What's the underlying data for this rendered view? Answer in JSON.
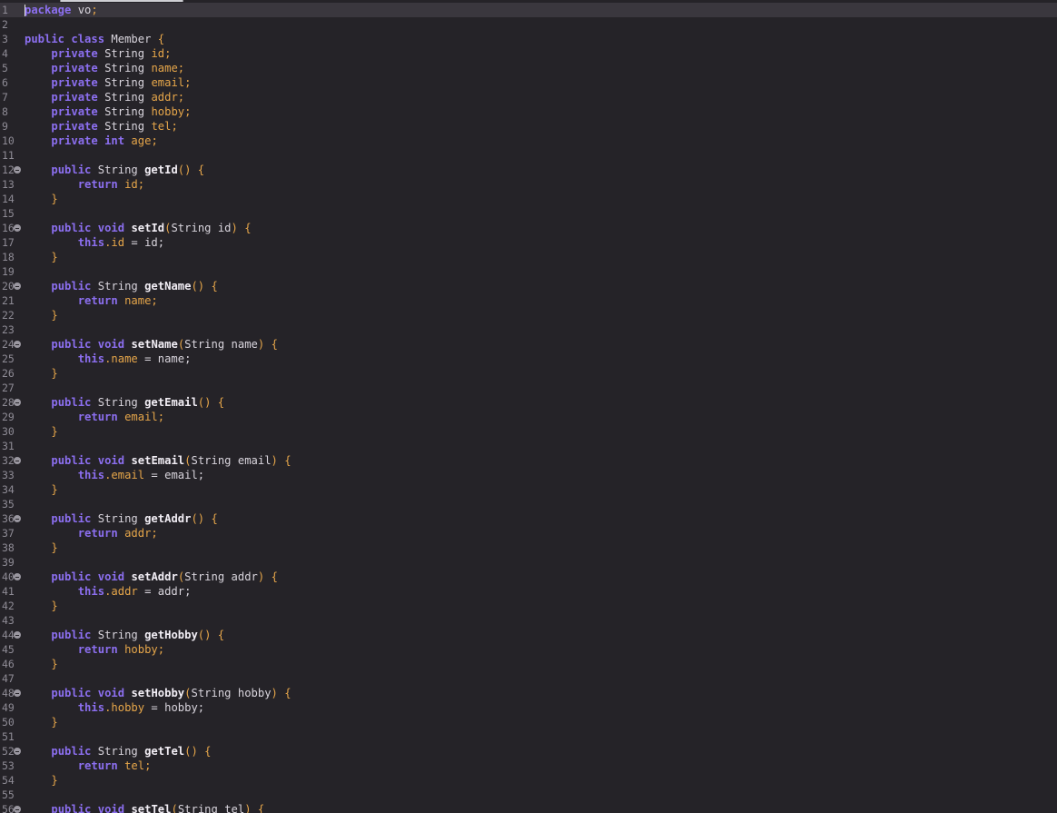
{
  "editor": {
    "language": "java",
    "current_line": 1,
    "colors": {
      "background": "#252328",
      "current_line": "#3a373e",
      "keyword": "#8c6ff0",
      "field": "#e6a64a",
      "method": "#f2eef5",
      "text": "#d9d5dd",
      "line_number": "#8e8b95"
    },
    "fold_icon": "collapse-circle-icon",
    "lines": [
      {
        "n": "1",
        "fold": false,
        "tokens": [
          {
            "t": "package",
            "c": "kw"
          },
          {
            "t": " vo",
            "c": "pl"
          },
          {
            "t": ";",
            "c": "pr"
          }
        ]
      },
      {
        "n": "2",
        "fold": false,
        "tokens": []
      },
      {
        "n": "3",
        "fold": false,
        "tokens": [
          {
            "t": "public",
            "c": "kw"
          },
          {
            "t": " ",
            "c": "pl"
          },
          {
            "t": "class",
            "c": "kw"
          },
          {
            "t": " Member ",
            "c": "ty"
          },
          {
            "t": "{",
            "c": "pr"
          }
        ]
      },
      {
        "n": "4",
        "fold": false,
        "tokens": [
          {
            "t": "    ",
            "c": "pl"
          },
          {
            "t": "private",
            "c": "kw"
          },
          {
            "t": " String ",
            "c": "ty"
          },
          {
            "t": "id;",
            "c": "fld"
          }
        ]
      },
      {
        "n": "5",
        "fold": false,
        "tokens": [
          {
            "t": "    ",
            "c": "pl"
          },
          {
            "t": "private",
            "c": "kw"
          },
          {
            "t": " String ",
            "c": "ty"
          },
          {
            "t": "name;",
            "c": "fld"
          }
        ]
      },
      {
        "n": "6",
        "fold": false,
        "tokens": [
          {
            "t": "    ",
            "c": "pl"
          },
          {
            "t": "private",
            "c": "kw"
          },
          {
            "t": " String ",
            "c": "ty"
          },
          {
            "t": "email;",
            "c": "fld"
          }
        ]
      },
      {
        "n": "7",
        "fold": false,
        "tokens": [
          {
            "t": "    ",
            "c": "pl"
          },
          {
            "t": "private",
            "c": "kw"
          },
          {
            "t": " String ",
            "c": "ty"
          },
          {
            "t": "addr;",
            "c": "fld"
          }
        ]
      },
      {
        "n": "8",
        "fold": false,
        "tokens": [
          {
            "t": "    ",
            "c": "pl"
          },
          {
            "t": "private",
            "c": "kw"
          },
          {
            "t": " String ",
            "c": "ty"
          },
          {
            "t": "hobby;",
            "c": "fld"
          }
        ]
      },
      {
        "n": "9",
        "fold": false,
        "tokens": [
          {
            "t": "    ",
            "c": "pl"
          },
          {
            "t": "private",
            "c": "kw"
          },
          {
            "t": " String ",
            "c": "ty"
          },
          {
            "t": "tel;",
            "c": "fld"
          }
        ]
      },
      {
        "n": "10",
        "fold": false,
        "tokens": [
          {
            "t": "    ",
            "c": "pl"
          },
          {
            "t": "private",
            "c": "kw"
          },
          {
            "t": " ",
            "c": "pl"
          },
          {
            "t": "int",
            "c": "kw"
          },
          {
            "t": " age;",
            "c": "fld"
          }
        ]
      },
      {
        "n": "11",
        "fold": false,
        "tokens": []
      },
      {
        "n": "12",
        "fold": true,
        "tokens": [
          {
            "t": "    ",
            "c": "pl"
          },
          {
            "t": "public",
            "c": "kw"
          },
          {
            "t": " String ",
            "c": "ty"
          },
          {
            "t": "getId",
            "c": "fn"
          },
          {
            "t": "() {",
            "c": "pr"
          }
        ]
      },
      {
        "n": "13",
        "fold": false,
        "tokens": [
          {
            "t": "        ",
            "c": "pl"
          },
          {
            "t": "return",
            "c": "kw"
          },
          {
            "t": " id;",
            "c": "fld"
          }
        ]
      },
      {
        "n": "14",
        "fold": false,
        "tokens": [
          {
            "t": "    ",
            "c": "pl"
          },
          {
            "t": "}",
            "c": "pr"
          }
        ]
      },
      {
        "n": "15",
        "fold": false,
        "tokens": []
      },
      {
        "n": "16",
        "fold": true,
        "tokens": [
          {
            "t": "    ",
            "c": "pl"
          },
          {
            "t": "public",
            "c": "kw"
          },
          {
            "t": " ",
            "c": "pl"
          },
          {
            "t": "void",
            "c": "kw"
          },
          {
            "t": " ",
            "c": "pl"
          },
          {
            "t": "setId",
            "c": "fn"
          },
          {
            "t": "(",
            "c": "pr"
          },
          {
            "t": "String ",
            "c": "ty"
          },
          {
            "t": "id",
            "c": "pl"
          },
          {
            "t": ") {",
            "c": "pr"
          }
        ]
      },
      {
        "n": "17",
        "fold": false,
        "tokens": [
          {
            "t": "        ",
            "c": "pl"
          },
          {
            "t": "this",
            "c": "kw"
          },
          {
            "t": ".id",
            "c": "fld"
          },
          {
            "t": " = id;",
            "c": "pl"
          }
        ]
      },
      {
        "n": "18",
        "fold": false,
        "tokens": [
          {
            "t": "    ",
            "c": "pl"
          },
          {
            "t": "}",
            "c": "pr"
          }
        ]
      },
      {
        "n": "19",
        "fold": false,
        "tokens": []
      },
      {
        "n": "20",
        "fold": true,
        "tokens": [
          {
            "t": "    ",
            "c": "pl"
          },
          {
            "t": "public",
            "c": "kw"
          },
          {
            "t": " String ",
            "c": "ty"
          },
          {
            "t": "getName",
            "c": "fn"
          },
          {
            "t": "() {",
            "c": "pr"
          }
        ]
      },
      {
        "n": "21",
        "fold": false,
        "tokens": [
          {
            "t": "        ",
            "c": "pl"
          },
          {
            "t": "return",
            "c": "kw"
          },
          {
            "t": " name;",
            "c": "fld"
          }
        ]
      },
      {
        "n": "22",
        "fold": false,
        "tokens": [
          {
            "t": "    ",
            "c": "pl"
          },
          {
            "t": "}",
            "c": "pr"
          }
        ]
      },
      {
        "n": "23",
        "fold": false,
        "tokens": []
      },
      {
        "n": "24",
        "fold": true,
        "tokens": [
          {
            "t": "    ",
            "c": "pl"
          },
          {
            "t": "public",
            "c": "kw"
          },
          {
            "t": " ",
            "c": "pl"
          },
          {
            "t": "void",
            "c": "kw"
          },
          {
            "t": " ",
            "c": "pl"
          },
          {
            "t": "setName",
            "c": "fn"
          },
          {
            "t": "(",
            "c": "pr"
          },
          {
            "t": "String ",
            "c": "ty"
          },
          {
            "t": "name",
            "c": "pl"
          },
          {
            "t": ") {",
            "c": "pr"
          }
        ]
      },
      {
        "n": "25",
        "fold": false,
        "tokens": [
          {
            "t": "        ",
            "c": "pl"
          },
          {
            "t": "this",
            "c": "kw"
          },
          {
            "t": ".name",
            "c": "fld"
          },
          {
            "t": " = name;",
            "c": "pl"
          }
        ]
      },
      {
        "n": "26",
        "fold": false,
        "tokens": [
          {
            "t": "    ",
            "c": "pl"
          },
          {
            "t": "}",
            "c": "pr"
          }
        ]
      },
      {
        "n": "27",
        "fold": false,
        "tokens": []
      },
      {
        "n": "28",
        "fold": true,
        "tokens": [
          {
            "t": "    ",
            "c": "pl"
          },
          {
            "t": "public",
            "c": "kw"
          },
          {
            "t": " String ",
            "c": "ty"
          },
          {
            "t": "getEmail",
            "c": "fn"
          },
          {
            "t": "() {",
            "c": "pr"
          }
        ]
      },
      {
        "n": "29",
        "fold": false,
        "tokens": [
          {
            "t": "        ",
            "c": "pl"
          },
          {
            "t": "return",
            "c": "kw"
          },
          {
            "t": " email;",
            "c": "fld"
          }
        ]
      },
      {
        "n": "30",
        "fold": false,
        "tokens": [
          {
            "t": "    ",
            "c": "pl"
          },
          {
            "t": "}",
            "c": "pr"
          }
        ]
      },
      {
        "n": "31",
        "fold": false,
        "tokens": []
      },
      {
        "n": "32",
        "fold": true,
        "tokens": [
          {
            "t": "    ",
            "c": "pl"
          },
          {
            "t": "public",
            "c": "kw"
          },
          {
            "t": " ",
            "c": "pl"
          },
          {
            "t": "void",
            "c": "kw"
          },
          {
            "t": " ",
            "c": "pl"
          },
          {
            "t": "setEmail",
            "c": "fn"
          },
          {
            "t": "(",
            "c": "pr"
          },
          {
            "t": "String ",
            "c": "ty"
          },
          {
            "t": "email",
            "c": "pl"
          },
          {
            "t": ") {",
            "c": "pr"
          }
        ]
      },
      {
        "n": "33",
        "fold": false,
        "tokens": [
          {
            "t": "        ",
            "c": "pl"
          },
          {
            "t": "this",
            "c": "kw"
          },
          {
            "t": ".email",
            "c": "fld"
          },
          {
            "t": " = email;",
            "c": "pl"
          }
        ]
      },
      {
        "n": "34",
        "fold": false,
        "tokens": [
          {
            "t": "    ",
            "c": "pl"
          },
          {
            "t": "}",
            "c": "pr"
          }
        ]
      },
      {
        "n": "35",
        "fold": false,
        "tokens": []
      },
      {
        "n": "36",
        "fold": true,
        "tokens": [
          {
            "t": "    ",
            "c": "pl"
          },
          {
            "t": "public",
            "c": "kw"
          },
          {
            "t": " String ",
            "c": "ty"
          },
          {
            "t": "getAddr",
            "c": "fn"
          },
          {
            "t": "() {",
            "c": "pr"
          }
        ]
      },
      {
        "n": "37",
        "fold": false,
        "tokens": [
          {
            "t": "        ",
            "c": "pl"
          },
          {
            "t": "return",
            "c": "kw"
          },
          {
            "t": " addr;",
            "c": "fld"
          }
        ]
      },
      {
        "n": "38",
        "fold": false,
        "tokens": [
          {
            "t": "    ",
            "c": "pl"
          },
          {
            "t": "}",
            "c": "pr"
          }
        ]
      },
      {
        "n": "39",
        "fold": false,
        "tokens": []
      },
      {
        "n": "40",
        "fold": true,
        "tokens": [
          {
            "t": "    ",
            "c": "pl"
          },
          {
            "t": "public",
            "c": "kw"
          },
          {
            "t": " ",
            "c": "pl"
          },
          {
            "t": "void",
            "c": "kw"
          },
          {
            "t": " ",
            "c": "pl"
          },
          {
            "t": "setAddr",
            "c": "fn"
          },
          {
            "t": "(",
            "c": "pr"
          },
          {
            "t": "String ",
            "c": "ty"
          },
          {
            "t": "addr",
            "c": "pl"
          },
          {
            "t": ") {",
            "c": "pr"
          }
        ]
      },
      {
        "n": "41",
        "fold": false,
        "tokens": [
          {
            "t": "        ",
            "c": "pl"
          },
          {
            "t": "this",
            "c": "kw"
          },
          {
            "t": ".addr",
            "c": "fld"
          },
          {
            "t": " = addr;",
            "c": "pl"
          }
        ]
      },
      {
        "n": "42",
        "fold": false,
        "tokens": [
          {
            "t": "    ",
            "c": "pl"
          },
          {
            "t": "}",
            "c": "pr"
          }
        ]
      },
      {
        "n": "43",
        "fold": false,
        "tokens": []
      },
      {
        "n": "44",
        "fold": true,
        "tokens": [
          {
            "t": "    ",
            "c": "pl"
          },
          {
            "t": "public",
            "c": "kw"
          },
          {
            "t": " String ",
            "c": "ty"
          },
          {
            "t": "getHobby",
            "c": "fn"
          },
          {
            "t": "() {",
            "c": "pr"
          }
        ]
      },
      {
        "n": "45",
        "fold": false,
        "tokens": [
          {
            "t": "        ",
            "c": "pl"
          },
          {
            "t": "return",
            "c": "kw"
          },
          {
            "t": " hobby;",
            "c": "fld"
          }
        ]
      },
      {
        "n": "46",
        "fold": false,
        "tokens": [
          {
            "t": "    ",
            "c": "pl"
          },
          {
            "t": "}",
            "c": "pr"
          }
        ]
      },
      {
        "n": "47",
        "fold": false,
        "tokens": []
      },
      {
        "n": "48",
        "fold": true,
        "tokens": [
          {
            "t": "    ",
            "c": "pl"
          },
          {
            "t": "public",
            "c": "kw"
          },
          {
            "t": " ",
            "c": "pl"
          },
          {
            "t": "void",
            "c": "kw"
          },
          {
            "t": " ",
            "c": "pl"
          },
          {
            "t": "setHobby",
            "c": "fn"
          },
          {
            "t": "(",
            "c": "pr"
          },
          {
            "t": "String ",
            "c": "ty"
          },
          {
            "t": "hobby",
            "c": "pl"
          },
          {
            "t": ") {",
            "c": "pr"
          }
        ]
      },
      {
        "n": "49",
        "fold": false,
        "tokens": [
          {
            "t": "        ",
            "c": "pl"
          },
          {
            "t": "this",
            "c": "kw"
          },
          {
            "t": ".hobby",
            "c": "fld"
          },
          {
            "t": " = hobby;",
            "c": "pl"
          }
        ]
      },
      {
        "n": "50",
        "fold": false,
        "tokens": [
          {
            "t": "    ",
            "c": "pl"
          },
          {
            "t": "}",
            "c": "pr"
          }
        ]
      },
      {
        "n": "51",
        "fold": false,
        "tokens": []
      },
      {
        "n": "52",
        "fold": true,
        "tokens": [
          {
            "t": "    ",
            "c": "pl"
          },
          {
            "t": "public",
            "c": "kw"
          },
          {
            "t": " String ",
            "c": "ty"
          },
          {
            "t": "getTel",
            "c": "fn"
          },
          {
            "t": "() {",
            "c": "pr"
          }
        ]
      },
      {
        "n": "53",
        "fold": false,
        "tokens": [
          {
            "t": "        ",
            "c": "pl"
          },
          {
            "t": "return",
            "c": "kw"
          },
          {
            "t": " tel;",
            "c": "fld"
          }
        ]
      },
      {
        "n": "54",
        "fold": false,
        "tokens": [
          {
            "t": "    ",
            "c": "pl"
          },
          {
            "t": "}",
            "c": "pr"
          }
        ]
      },
      {
        "n": "55",
        "fold": false,
        "tokens": []
      },
      {
        "n": "56",
        "fold": true,
        "tokens": [
          {
            "t": "    ",
            "c": "pl"
          },
          {
            "t": "public",
            "c": "kw"
          },
          {
            "t": " ",
            "c": "pl"
          },
          {
            "t": "void",
            "c": "kw"
          },
          {
            "t": " ",
            "c": "pl"
          },
          {
            "t": "setTel",
            "c": "fn"
          },
          {
            "t": "(",
            "c": "pr"
          },
          {
            "t": "String ",
            "c": "ty"
          },
          {
            "t": "tel",
            "c": "pl"
          },
          {
            "t": ") {",
            "c": "pr"
          }
        ]
      }
    ]
  }
}
